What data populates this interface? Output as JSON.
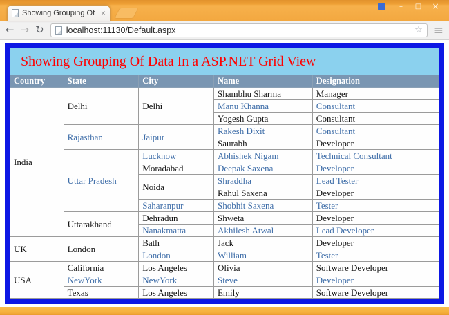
{
  "browser": {
    "tab_title": "Showing Grouping Of Dat",
    "tab_close": "×",
    "window_controls": {
      "minimize": "–",
      "maximize": "□",
      "close": "×"
    },
    "nav": {
      "back": "←",
      "forward": "→",
      "refresh": "↻"
    },
    "omnibox": {
      "url": "localhost:11130/Default.aspx",
      "bookmark_star": "☆"
    },
    "menu": "≡"
  },
  "page": {
    "title": "Showing Grouping Of Data In a ASP.NET Grid View"
  },
  "grid": {
    "headers": [
      "Country",
      "State",
      "City",
      "Name",
      "Designation"
    ],
    "rows": [
      [
        {
          "t": "India",
          "rs": 12
        },
        {
          "t": "Delhi",
          "rs": 3
        },
        {
          "t": "Delhi",
          "rs": 3
        },
        {
          "t": "Shambhu Sharma"
        },
        {
          "t": "Manager"
        }
      ],
      [
        {
          "t": "Manu Khanna",
          "b": true
        },
        {
          "t": "Consultant",
          "b": true
        }
      ],
      [
        {
          "t": "Yogesh Gupta"
        },
        {
          "t": "Consultant"
        }
      ],
      [
        {
          "t": "Rajasthan",
          "rs": 2,
          "b": true
        },
        {
          "t": "Jaipur",
          "rs": 2,
          "b": true
        },
        {
          "t": "Rakesh Dixit",
          "b": true
        },
        {
          "t": "Consultant",
          "b": true
        }
      ],
      [
        {
          "t": "Saurabh"
        },
        {
          "t": "Developer"
        }
      ],
      [
        {
          "t": "Uttar Pradesh",
          "rs": 5,
          "b": true
        },
        {
          "t": "Lucknow",
          "b": true
        },
        {
          "t": "Abhishek Nigam",
          "b": true
        },
        {
          "t": "Technical Consultant",
          "b": true
        }
      ],
      [
        {
          "t": "Moradabad"
        },
        {
          "t": "Deepak Saxena",
          "b": true
        },
        {
          "t": "Developer",
          "b": true
        }
      ],
      [
        {
          "t": "Noida",
          "rs": 2
        },
        {
          "t": "Shraddha",
          "b": true
        },
        {
          "t": "Lead Tester",
          "b": true
        }
      ],
      [
        {
          "t": "Rahul Saxena"
        },
        {
          "t": "Developer"
        }
      ],
      [
        {
          "t": "Saharanpur",
          "b": true
        },
        {
          "t": "Shobhit Saxena",
          "b": true
        },
        {
          "t": "Tester",
          "b": true
        }
      ],
      [
        {
          "t": "Uttarakhand",
          "rs": 2
        },
        {
          "t": "Dehradun"
        },
        {
          "t": "Shweta"
        },
        {
          "t": "Developer"
        }
      ],
      [
        {
          "t": "Nanakmatta",
          "b": true
        },
        {
          "t": "Akhilesh Atwal",
          "b": true
        },
        {
          "t": "Lead Developer",
          "b": true
        }
      ],
      [
        {
          "t": "UK",
          "rs": 2
        },
        {
          "t": "London",
          "rs": 2
        },
        {
          "t": "Bath"
        },
        {
          "t": "Jack"
        },
        {
          "t": "Developer"
        }
      ],
      [
        {
          "t": "London",
          "b": true
        },
        {
          "t": "William",
          "b": true
        },
        {
          "t": "Tester",
          "b": true
        }
      ],
      [
        {
          "t": "USA",
          "rs": 3
        },
        {
          "t": "California"
        },
        {
          "t": "Los Angeles"
        },
        {
          "t": "Olivia"
        },
        {
          "t": "Software Developer"
        }
      ],
      [
        {
          "t": "NewYork",
          "b": true
        },
        {
          "t": "NewYork",
          "b": true
        },
        {
          "t": "Steve",
          "b": true
        },
        {
          "t": "Developer",
          "b": true
        }
      ],
      [
        {
          "t": "Texas"
        },
        {
          "t": "Los Angeles"
        },
        {
          "t": "Emily"
        },
        {
          "t": "Software Developer"
        }
      ]
    ]
  },
  "colors": {
    "frame_orange": "#F3A840",
    "page_border_blue": "#0D17E4",
    "page_bg_skyblue": "#8BD1EE",
    "title_red": "#FF0000",
    "header_bg": "#7A96B2",
    "alt_text_blue": "#3E6DA8"
  }
}
